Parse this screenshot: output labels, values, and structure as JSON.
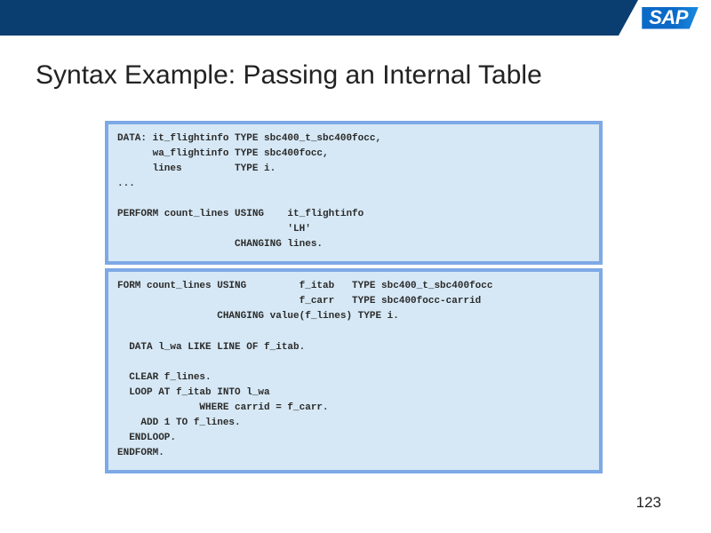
{
  "brand": {
    "logo_text": "SAP"
  },
  "slide": {
    "title": "Syntax Example: Passing an Internal Table",
    "page_number": "123"
  },
  "code": {
    "panel1": "DATA: it_flightinfo TYPE sbc400_t_sbc400focc,\n      wa_flightinfo TYPE sbc400focc,\n      lines         TYPE i.\n...\n\nPERFORM count_lines USING    it_flightinfo\n                             'LH'\n                    CHANGING lines.",
    "panel2": "FORM count_lines USING         f_itab   TYPE sbc400_t_sbc400focc\n                               f_carr   TYPE sbc400focc-carrid\n                 CHANGING value(f_lines) TYPE i.\n\n  DATA l_wa LIKE LINE OF f_itab.\n\n  CLEAR f_lines.\n  LOOP AT f_itab INTO l_wa\n              WHERE carrid = f_carr.\n    ADD 1 TO f_lines.\n  ENDLOOP.\nENDFORM."
  }
}
